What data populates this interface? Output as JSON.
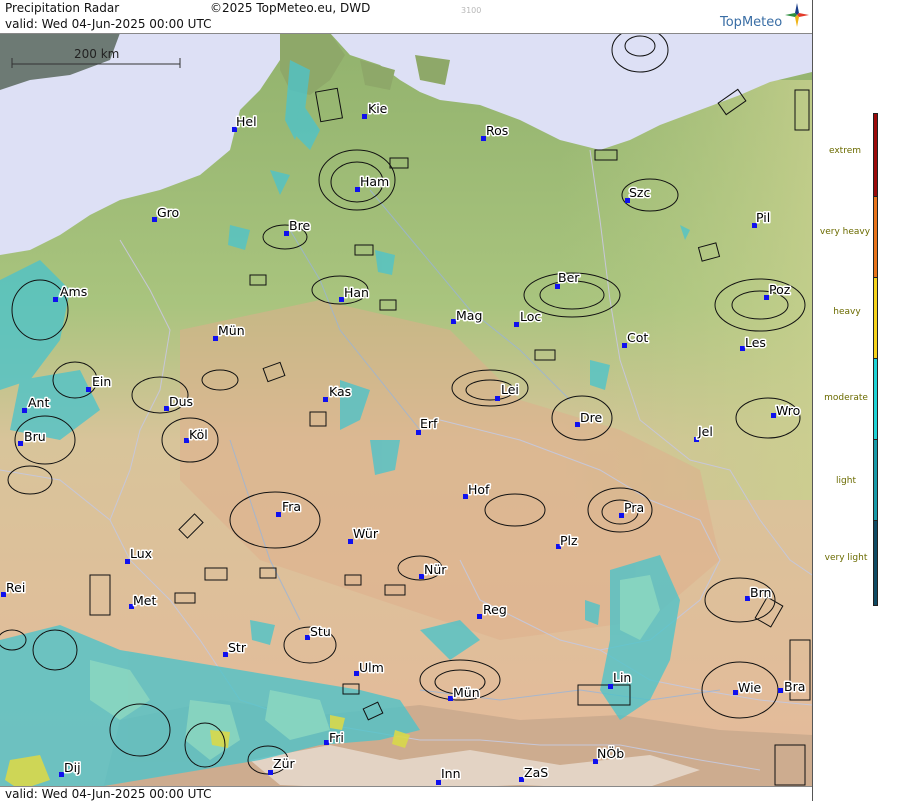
{
  "header": {
    "product": "Precipitation Radar",
    "copyright": "©2025 TopMeteo.eu, DWD",
    "valid": "valid:  Wed  04-Jun-2025 00:00 UTC",
    "faint_number": "3100",
    "logo": "TopMeteo"
  },
  "footer": {
    "valid": "valid:  Wed  04-Jun-2025 00:00 UTC"
  },
  "scale_bar": {
    "label": "200 km"
  },
  "legend": {
    "items": [
      {
        "label": "extrem",
        "color": "#9b0a0a"
      },
      {
        "label": "very heavy",
        "color": "#e8731a"
      },
      {
        "label": "heavy",
        "color": "#f6d31c"
      },
      {
        "label": "moderate",
        "color": "#1fd3d6"
      },
      {
        "label": "light",
        "color": "#179aa8"
      },
      {
        "label": "very light",
        "color": "#0e4a63"
      }
    ]
  },
  "cities": [
    {
      "name": "Hel"
    },
    {
      "name": "Kie"
    },
    {
      "name": "Ros"
    },
    {
      "name": "Ham"
    },
    {
      "name": "Szc"
    },
    {
      "name": "Gro"
    },
    {
      "name": "Bre"
    },
    {
      "name": "Pil"
    },
    {
      "name": "Ams"
    },
    {
      "name": "Han"
    },
    {
      "name": "Ber"
    },
    {
      "name": "Poz"
    },
    {
      "name": "Mün"
    },
    {
      "name": "Mag"
    },
    {
      "name": "Loc"
    },
    {
      "name": "Cot"
    },
    {
      "name": "Les"
    },
    {
      "name": "Ein"
    },
    {
      "name": "Kas"
    },
    {
      "name": "Lei"
    },
    {
      "name": "Ant"
    },
    {
      "name": "Dus"
    },
    {
      "name": "Dre"
    },
    {
      "name": "Wro"
    },
    {
      "name": "Bru"
    },
    {
      "name": "Köl"
    },
    {
      "name": "Erf"
    },
    {
      "name": "Jel"
    },
    {
      "name": "Hof"
    },
    {
      "name": "Fra"
    },
    {
      "name": "Pra"
    },
    {
      "name": "Wür"
    },
    {
      "name": "Plz"
    },
    {
      "name": "Lux"
    },
    {
      "name": "Nür"
    },
    {
      "name": "Rei"
    },
    {
      "name": "Met"
    },
    {
      "name": "Brn"
    },
    {
      "name": "Reg"
    },
    {
      "name": "Stu"
    },
    {
      "name": "Str"
    },
    {
      "name": "Ulm"
    },
    {
      "name": "Lin"
    },
    {
      "name": "Mün"
    },
    {
      "name": "Wie"
    },
    {
      "name": "Bra"
    },
    {
      "name": "Fri"
    },
    {
      "name": "NÖb"
    },
    {
      "name": "Dij"
    },
    {
      "name": "Zür"
    },
    {
      "name": "Inn"
    },
    {
      "name": "ZaS"
    }
  ],
  "colors": {
    "sea": "#dde0f5",
    "lowland": "#9fbf78",
    "mountain": "#e4b898",
    "radar_light": "#4fc3c9",
    "radar_moderate": "#8ad6c0",
    "radar_heavy": "#d8d84a"
  }
}
